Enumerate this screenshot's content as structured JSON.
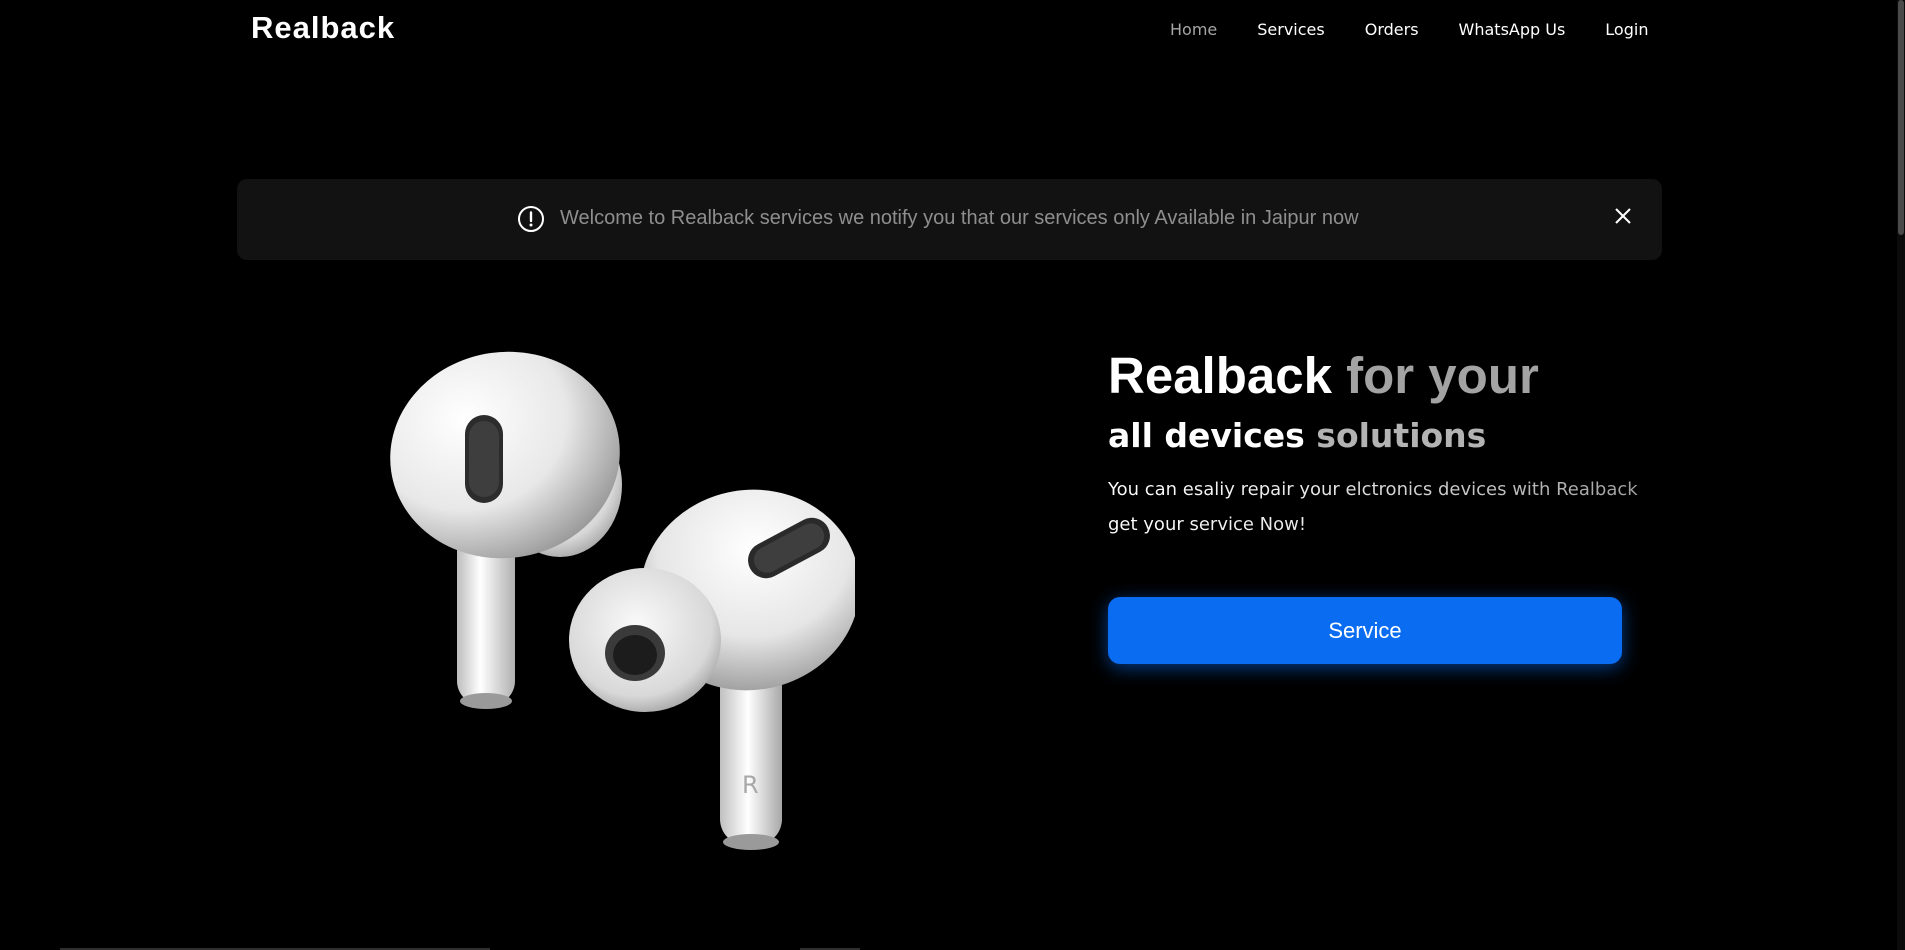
{
  "header": {
    "brand": "Realback",
    "nav": [
      {
        "label": "Home",
        "active": true
      },
      {
        "label": "Services",
        "active": false
      },
      {
        "label": "Orders",
        "active": false
      },
      {
        "label": "WhatsApp Us",
        "active": false
      },
      {
        "label": "Login",
        "active": false
      }
    ]
  },
  "alert": {
    "icon": "exclamation-circle-icon",
    "message": "Welcome to Realback services we notify you that our services only Available in Jaipur now",
    "close_icon": "close-icon"
  },
  "hero": {
    "image": "earbuds-image",
    "title_main": "Realback",
    "title_rest": "for your",
    "subtitle_main": "all devices",
    "subtitle_rest": "solutions",
    "description": "You can esaliy repair your elctronics devices with Realback get your service Now!",
    "earbud_letter": "R",
    "button_label": "Service",
    "button_color": "#0a6cf0"
  }
}
